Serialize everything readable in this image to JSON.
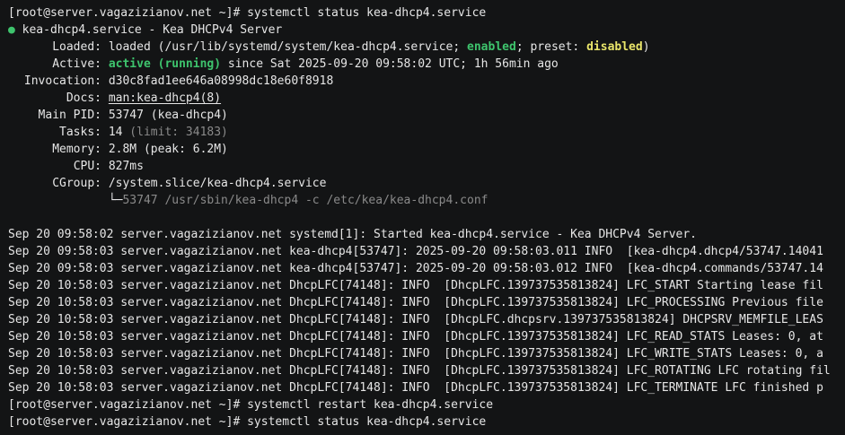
{
  "terminal": {
    "prompt": "[root@server.vagazizianov.net ~]# ",
    "command_first": "systemctl status kea-dhcp4.service",
    "status": {
      "bullet": "●",
      "header": "kea-dhcp4.service - Kea DHCPv4 Server",
      "loaded": {
        "label": "Loaded:",
        "prefix": "loaded (",
        "path": "/usr/lib/systemd/system/kea-dhcp4.service",
        "sep1": "; ",
        "enabled": "enabled",
        "sep2": "; preset: ",
        "preset": "disabled",
        "suffix": ")"
      },
      "active": {
        "label": "Active:",
        "state": "active (running)",
        "rest": " since Sat 2025-09-20 09:58:02 UTC; 1h 56min ago"
      },
      "invocation": {
        "label": "Invocation:",
        "value": "d30c8fad1ee646a08998dc18e60f8918"
      },
      "docs": {
        "label": "Docs:",
        "value": "man:kea-dhcp4(8)"
      },
      "main_pid": {
        "label": "Main PID:",
        "value": "53747 (kea-dhcp4)"
      },
      "tasks": {
        "label": "Tasks:",
        "value": "14",
        "limit": " (limit: 34183)"
      },
      "memory": {
        "label": "Memory:",
        "value": "2.8M (peak: 6.2M)"
      },
      "cpu": {
        "label": "CPU:",
        "value": "827ms"
      },
      "cgroup": {
        "label": "CGroup:",
        "value": "/system.slice/kea-dhcp4.service",
        "tree_branch": "└─",
        "process": "53747 /usr/sbin/kea-dhcp4 -c /etc/kea/kea-dhcp4.conf"
      }
    },
    "log_lines": [
      "Sep 20 09:58:02 server.vagazizianov.net systemd[1]: Started kea-dhcp4.service - Kea DHCPv4 Server.",
      "Sep 20 09:58:03 server.vagazizianov.net kea-dhcp4[53747]: 2025-09-20 09:58:03.011 INFO  [kea-dhcp4.dhcp4/53747.14041",
      "Sep 20 09:58:03 server.vagazizianov.net kea-dhcp4[53747]: 2025-09-20 09:58:03.012 INFO  [kea-dhcp4.commands/53747.14",
      "Sep 20 10:58:03 server.vagazizianov.net DhcpLFC[74148]: INFO  [DhcpLFC.139737535813824] LFC_START Starting lease fil",
      "Sep 20 10:58:03 server.vagazizianov.net DhcpLFC[74148]: INFO  [DhcpLFC.139737535813824] LFC_PROCESSING Previous file",
      "Sep 20 10:58:03 server.vagazizianov.net DhcpLFC[74148]: INFO  [DhcpLFC.dhcpsrv.139737535813824] DHCPSRV_MEMFILE_LEAS",
      "Sep 20 10:58:03 server.vagazizianov.net DhcpLFC[74148]: INFO  [DhcpLFC.139737535813824] LFC_READ_STATS Leases: 0, at",
      "Sep 20 10:58:03 server.vagazizianov.net DhcpLFC[74148]: INFO  [DhcpLFC.139737535813824] LFC_WRITE_STATS Leases: 0, a",
      "Sep 20 10:58:03 server.vagazizianov.net DhcpLFC[74148]: INFO  [DhcpLFC.139737535813824] LFC_ROTATING LFC rotating fil",
      "Sep 20 10:58:03 server.vagazizianov.net DhcpLFC[74148]: INFO  [DhcpLFC.139737535813824] LFC_TERMINATE LFC finished p"
    ],
    "command_restart": "systemctl restart kea-dhcp4.service",
    "command_last": "systemctl status kea-dhcp4.service"
  }
}
